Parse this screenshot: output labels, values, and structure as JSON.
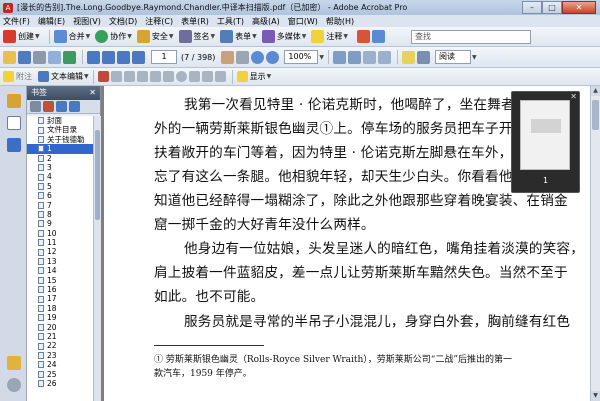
{
  "window": {
    "title": "[漫长的告别].The.Long.Goodbye.Raymond.Chandler.中译本扫描版.pdf（已加密） - Adobe Acrobat Pro",
    "min_label": "–",
    "max_label": "□",
    "close_label": "✕"
  },
  "menu": [
    "文件(F)",
    "编辑(E)",
    "视图(V)",
    "文档(D)",
    "注释(C)",
    "表单(R)",
    "工具(T)",
    "高级(A)",
    "窗口(W)",
    "帮助(H)"
  ],
  "toolbar1": {
    "create": "创建",
    "combine": "合并",
    "collaborate": "协作",
    "secure": "安全",
    "sign": "签名",
    "forms": "表单",
    "multimedia": "多媒体",
    "comment": "注释",
    "search_placeholder": "查找"
  },
  "toolbar2": {
    "page_current": "1",
    "page_total": "(7 / 398)",
    "zoom": "100%",
    "view_mode": "阅读"
  },
  "toolbar3": {
    "attach": "附注",
    "text_edit": "文本编辑",
    "show": "显示"
  },
  "panel": {
    "title": "书签",
    "close": "✕",
    "bookmarks": [
      "封面",
      "文件目录",
      "关于钱德勒",
      "1",
      "2",
      "3",
      "4",
      "5",
      "6",
      "7",
      "8",
      "9",
      "10",
      "11",
      "12",
      "13",
      "14",
      "15",
      "16",
      "17",
      "18",
      "19",
      "20",
      "21",
      "22",
      "23",
      "24",
      "25",
      "26"
    ],
    "selected_index": 3
  },
  "document": {
    "lines": [
      "我第一次看见特里 · 伦诺克斯时，他喝醉了，坐在舞者酒吧",
      "外的一辆劳斯莱斯银色幽灵①上。停车场的服务员把车子开出来，",
      "扶着敞开的车门等着，因为特里 · 伦诺克斯左脚悬在车外，仿佛",
      "忘了有这么一条腿。他相貌年轻，却天生少白头。你看看他的眼睛",
      "知道他已经醉得一塌糊涂了，除此之外他跟那些穿着晚宴装、在销金",
      "窟一掷千金的大好青年没什么两样。",
      "他身边有一位姑娘，头发呈迷人的暗红色，嘴角挂着淡漠的笑容，",
      "肩上披着一件蓝貂皮，差一点儿让劳斯莱斯车黯然失色。当然不至于",
      "如此。也不可能。",
      "服务员就是寻常的半吊子小混混儿，身穿白外套，胸前缝有红色"
    ],
    "footnote_1": "① 劳斯莱斯银色幽灵（Rolls-Royce Silver Wraith），劳斯莱斯公司“二战”后推出的第一",
    "footnote_2": "款汽车，1959 年停产。"
  },
  "thumbnail_popup": {
    "page_label": "1",
    "close": "✕"
  },
  "colors": {
    "accent_selection": "#3366cc",
    "panel_header": "#4d5d74",
    "doc_background": "#7f7f7f"
  }
}
